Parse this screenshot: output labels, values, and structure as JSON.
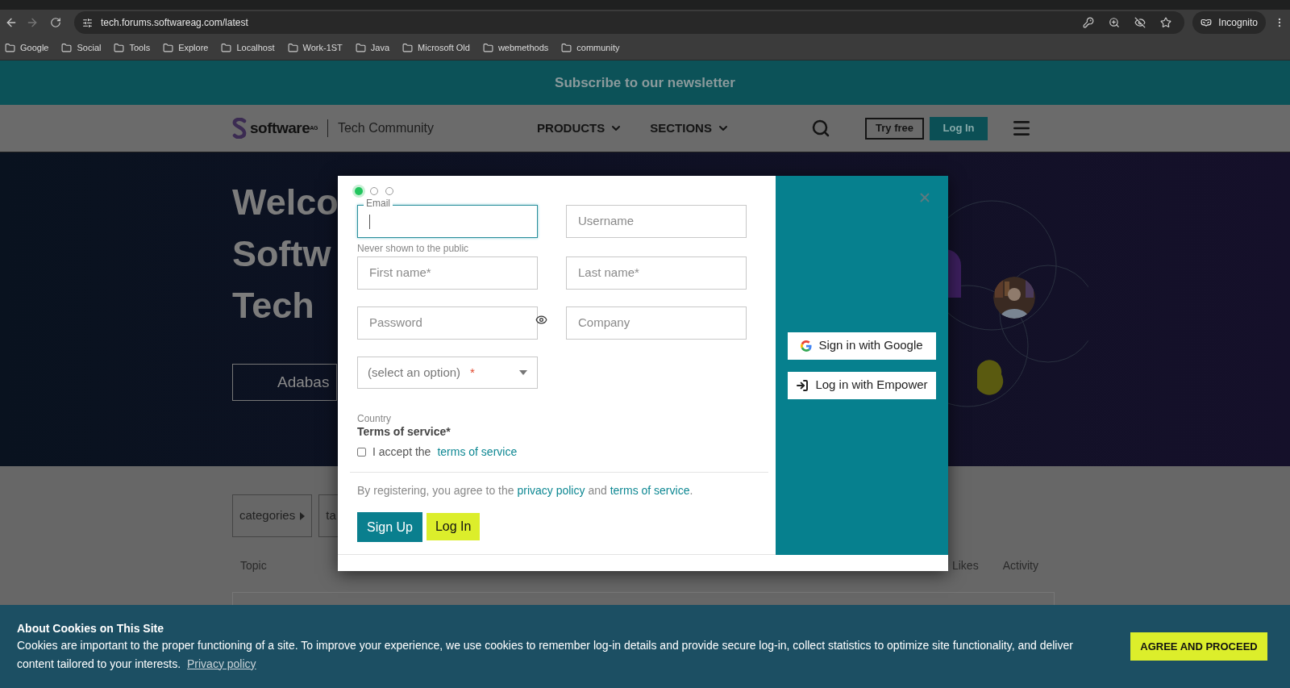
{
  "browser": {
    "url": "tech.forums.softwareag.com/latest",
    "profile": "Incognito",
    "forward_disabled": true,
    "bookmarks": [
      "Google",
      "Social",
      "Tools",
      "Explore",
      "Localhost",
      "Work-1ST",
      "Java",
      "Microsoft Old",
      "webmethods",
      "community"
    ]
  },
  "newsletter_bar": {
    "text": "Subscribe to our newsletter"
  },
  "header": {
    "logo": "software$^{AG}$",
    "site": "Tech Community",
    "nav": [
      "PRODUCTS",
      "SECTIONS"
    ],
    "try_free": "Try free",
    "login": "Log In"
  },
  "hero": {
    "heading_lines": [
      "Welco",
      "Softw",
      "Tech"
    ],
    "button": "Adabas"
  },
  "topics": {
    "filters": [
      "categories",
      "ta"
    ],
    "columns": [
      "Topic",
      "Likes",
      "Activity"
    ]
  },
  "modal": {
    "steps": [
      {
        "selected": true
      },
      {
        "selected": false
      },
      {
        "selected": false
      }
    ],
    "fields": [
      {
        "label": "Email",
        "focused": true,
        "hint": "Never shown to the public"
      },
      {
        "placeholder": "Username",
        "focused": false
      },
      {
        "placeholder": "First name*",
        "focused": false
      },
      {
        "placeholder": "Last name*",
        "focused": false
      },
      {
        "placeholder": "Password",
        "focused": false,
        "kind": "password"
      },
      {
        "placeholder": "Company",
        "focused": false
      }
    ],
    "country": {
      "value": "(select an option)",
      "required_mark": "*",
      "label": "Country"
    },
    "terms": {
      "title": "Terms of service*",
      "checked": false,
      "text": "I accept the",
      "link": "terms of service"
    },
    "agreement": {
      "text": "By registering, you agree to the",
      "link1": "privacy policy",
      "middle": "and",
      "link2": "terms of service",
      "end": "."
    },
    "sign_up": "Sign Up",
    "log_in": "Log In",
    "social": [
      {
        "kind": "google",
        "label": "Sign in with Google"
      },
      {
        "kind": "empower",
        "label": "Log in with Empower"
      }
    ]
  },
  "cookie_banner": {
    "title": "About Cookies on This Site",
    "text": "Cookies are important to the proper functioning of a site. To improve your experience, we use cookies to remember log-in details and provide secure log-in, collect statistics to optimize site functionality, and deliver content tailored to your interests.",
    "link": "Privacy policy",
    "button": "AGREE AND PROCEED"
  }
}
